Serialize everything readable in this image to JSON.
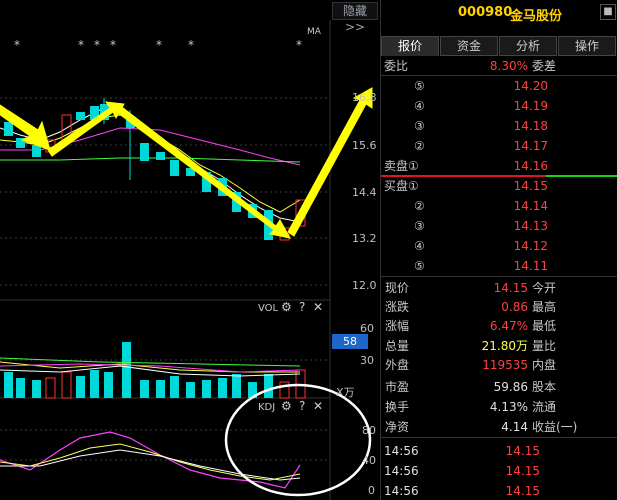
{
  "header": {
    "hide_label": "隐藏>>",
    "stock_code": "000980",
    "stock_name": "金马股份"
  },
  "tabs": [
    "报价",
    "资金",
    "分析",
    "操作"
  ],
  "main_chart": {
    "ma_label": "MA",
    "markers": [
      "*",
      "*",
      "*",
      "*",
      "*",
      "*",
      "*",
      "*"
    ],
    "y_ticks": [
      "16.8",
      "15.6",
      "14.4",
      "13.2",
      "12.0"
    ]
  },
  "vol_chart": {
    "label": "VOL",
    "y_ticks": [
      "60",
      "30"
    ],
    "unit": "X万",
    "current_value": "58"
  },
  "kdj_chart": {
    "label": "KDJ",
    "y_ticks": [
      "80",
      "40",
      "0"
    ]
  },
  "quote": {
    "weibi_label": "委比",
    "weibi_value": "8.30%",
    "weicha_label": "委差",
    "sell": [
      {
        "label": "⑤",
        "price": "14.20"
      },
      {
        "label": "④",
        "price": "14.19"
      },
      {
        "label": "③",
        "price": "14.18"
      },
      {
        "label": "②",
        "price": "14.17"
      },
      {
        "label": "卖盘①",
        "price": "14.16"
      }
    ],
    "buy": [
      {
        "label": "买盘①",
        "price": "14.15"
      },
      {
        "label": "②",
        "price": "14.14"
      },
      {
        "label": "③",
        "price": "14.13"
      },
      {
        "label": "④",
        "price": "14.12"
      },
      {
        "label": "⑤",
        "price": "14.11"
      }
    ],
    "stats": [
      {
        "l1": "现价",
        "v1": "14.15",
        "c1": "red",
        "l2": "今开"
      },
      {
        "l1": "涨跌",
        "v1": "0.86",
        "c1": "red",
        "l2": "最高"
      },
      {
        "l1": "涨幅",
        "v1": "6.47%",
        "c1": "red",
        "l2": "最低"
      },
      {
        "l1": "总量",
        "v1": "21.80万",
        "c1": "yellow",
        "l2": "量比"
      },
      {
        "l1": "外盘",
        "v1": "119535",
        "c1": "red",
        "l2": "内盘"
      },
      {
        "l1": "市盈",
        "v1": "59.86",
        "c1": "wht",
        "l2": "股本"
      },
      {
        "l1": "换手",
        "v1": "4.13%",
        "c1": "wht",
        "l2": "流通"
      },
      {
        "l1": "净资",
        "v1": "4.14",
        "c1": "wht",
        "l2": "收益(一)"
      }
    ],
    "ticks": [
      {
        "time": "14:56",
        "price": "14.15"
      },
      {
        "time": "14:56",
        "price": "14.15"
      },
      {
        "time": "14:56",
        "price": "14.15"
      }
    ]
  },
  "colors": {
    "up": "#ff3030",
    "down": "#00e0e0",
    "accent": "#ffd200",
    "annot": "#ffff00"
  }
}
